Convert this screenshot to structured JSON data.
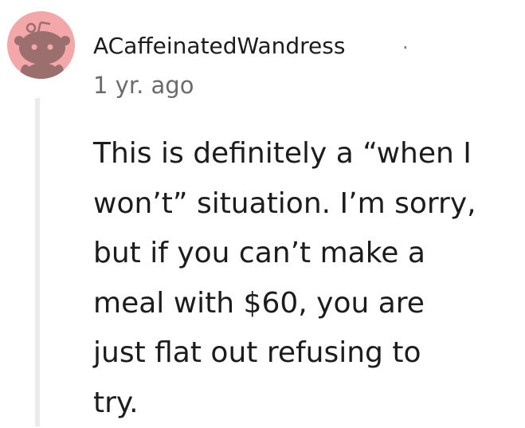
{
  "comment": {
    "author": "ACaffeinatedWandress",
    "separator": "·",
    "timestamp": "1 yr. ago",
    "body": "This is definitely a “when I\nwon’t” situation. I’m sorry,\nbut if you can’t make a\nmeal with $60, you are\njust flat out refusing to\ntry."
  },
  "avatar": {
    "icon": "reddit-snoo-icon",
    "background_color": "#f4a7a8",
    "figure_color": "#9b6f6e"
  },
  "colors": {
    "text": "#1c1c1c",
    "meta": "#6b6b6b",
    "thread_line": "#ebebeb"
  }
}
